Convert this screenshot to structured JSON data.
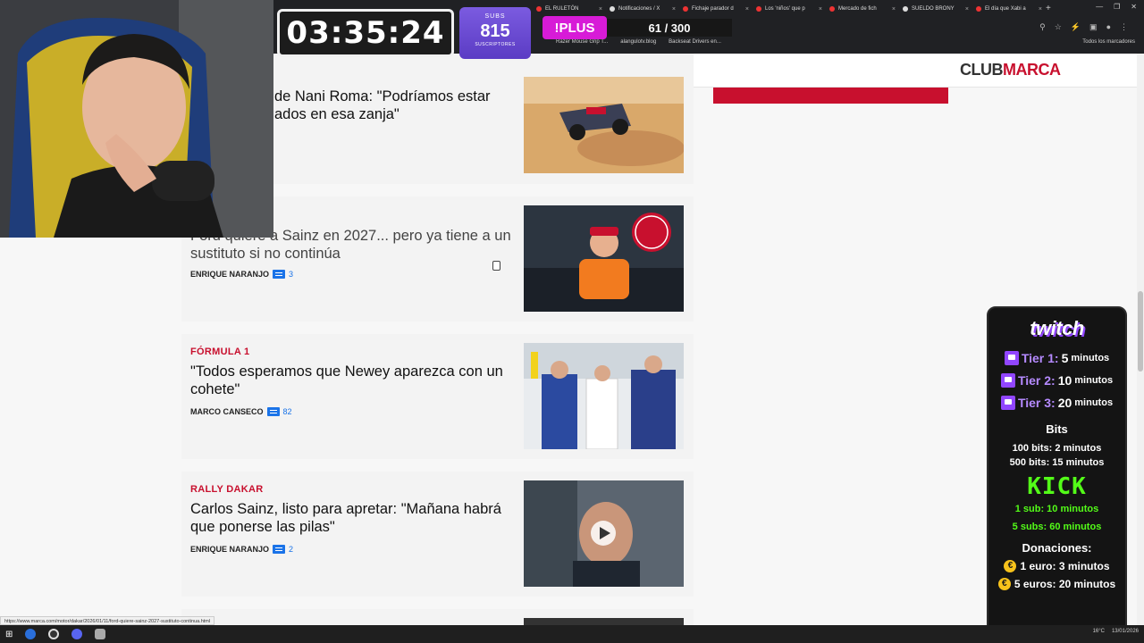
{
  "browser": {
    "tabs": [
      {
        "label": "EL RULETÓN",
        "fav": "#e33"
      },
      {
        "label": "Notificaciones / X",
        "fav": "#ddd"
      },
      {
        "label": "Fichaje parador d",
        "fav": "#e33"
      },
      {
        "label": "Los 'niños' que p",
        "fav": "#e33"
      },
      {
        "label": "Mercado de fich",
        "fav": "#e33"
      },
      {
        "label": "SUELDO BRONY",
        "fav": "#ddd"
      },
      {
        "label": "El día que Xabi a",
        "fav": "#e33"
      }
    ],
    "bookmarks": [
      "Razer Mouse Grip T...",
      "alangulotv.blog",
      "Backseat Drivers en..."
    ],
    "bookmarks_right": "Todos los marcadores"
  },
  "page": {
    "club": {
      "part1": "CLUB",
      "part2": "MARCA"
    },
    "articles": [
      {
        "kicker": "",
        "headline": "de Nani Roma: \"Podríamos estar\nados en esa zanja\"",
        "author": "",
        "comments": ""
      },
      {
        "kicker": "",
        "headline": "Ford quiere a Sainz en 2027... pero ya tiene a un sustituto si no continúa",
        "author": "ENRIQUE NARANJO",
        "comments": "3"
      },
      {
        "kicker": "FÓRMULA 1",
        "headline": "\"Todos esperamos que Newey aparezca con un cohete\"",
        "author": "MARCO CANSECO",
        "comments": "82"
      },
      {
        "kicker": "RALLY DAKAR",
        "headline": "Carlos Sainz, listo para apretar: \"Mañana habrá que ponerse las pilas\"",
        "author": "ENRIQUE NARANJO",
        "comments": "2"
      }
    ],
    "status_url": "https://www.marca.com/motor/dakar/2026/01/11/ford-quiere-sainz-2027-sustituto-continua.html"
  },
  "stream": {
    "timer": "03:35:24",
    "subs_label": "SUBS",
    "subs_count": "815",
    "subs_sub": "SUSCRIPTORES",
    "plus_label": "!PLUS",
    "count_text": "61 / 300",
    "panel": {
      "twitch": "twitch",
      "tiers": [
        {
          "label": "Tier 1:",
          "value": "5",
          "unit": "minutos"
        },
        {
          "label": "Tier 2:",
          "value": "10",
          "unit": "minutos"
        },
        {
          "label": "Tier 3:",
          "value": "20",
          "unit": "minutos"
        }
      ],
      "bits_title": "Bits",
      "bits": [
        "100 bits: 2 minutos",
        "500 bits: 15 minutos"
      ],
      "kick": "KICK",
      "kick_lines": [
        "1 sub: 10 minutos",
        "5 subs: 60 minutos"
      ],
      "donations_title": "Donaciones:",
      "donations": [
        "1 euro: 3 minutos",
        "5 euros: 20 minutos"
      ]
    }
  },
  "taskbar": {
    "tray": [
      "16°C",
      "13/01/2026"
    ]
  },
  "colors": {
    "marca_red": "#c8102e",
    "twitch_purple": "#9146ff",
    "kick_green": "#53fc18"
  }
}
